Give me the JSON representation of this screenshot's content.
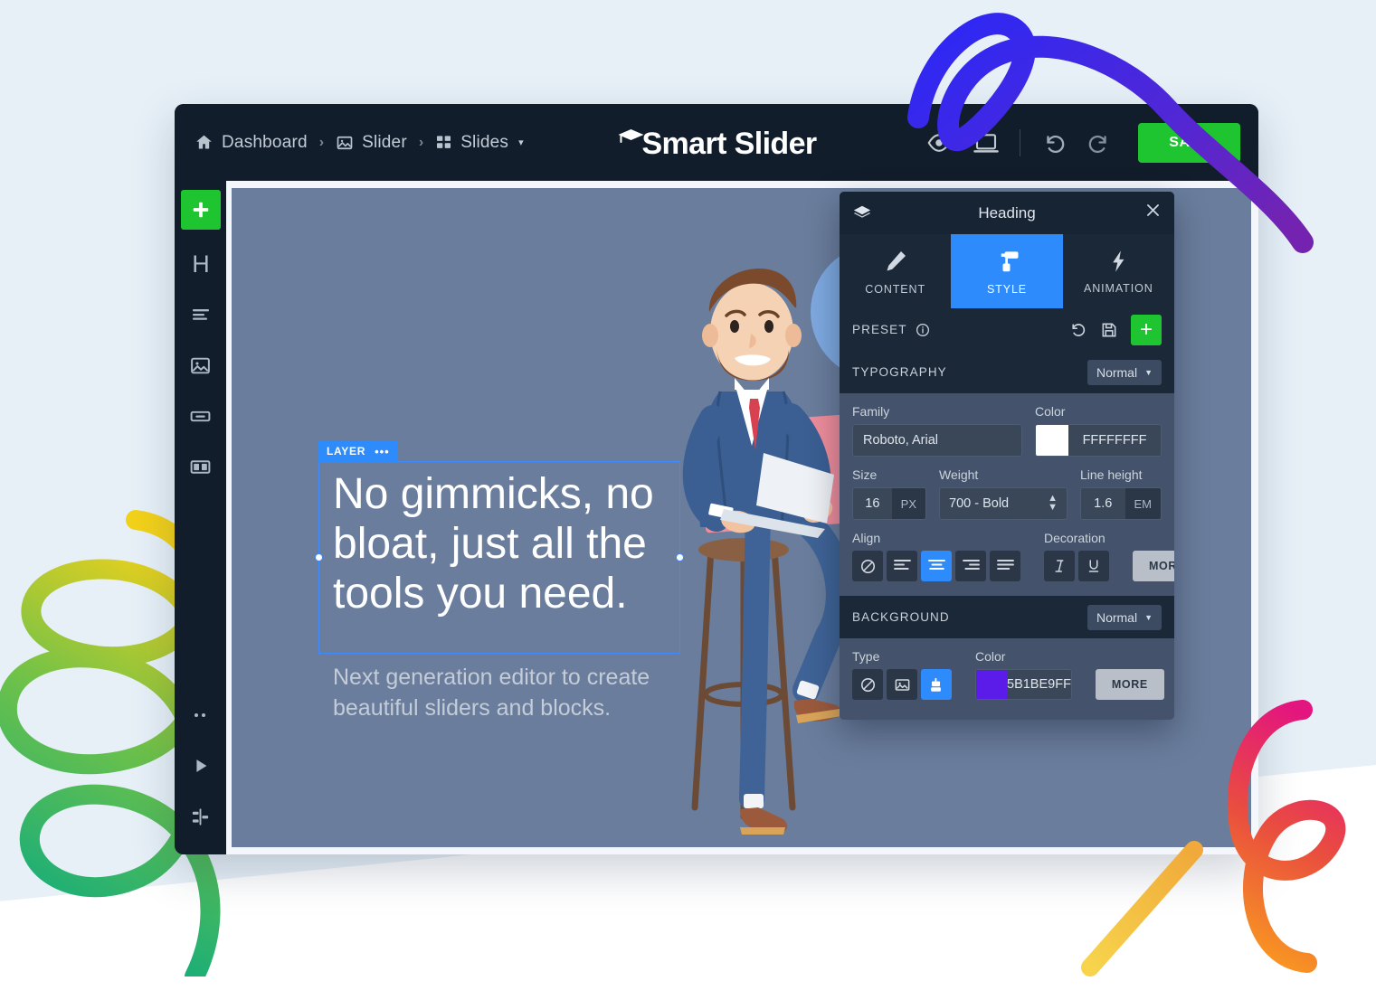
{
  "app": {
    "brand_name": "Smart Slider",
    "breadcrumb": [
      {
        "icon": "home-icon",
        "label": "Dashboard"
      },
      {
        "icon": "image-icon",
        "label": "Slider"
      },
      {
        "icon": "grid-icon",
        "label": "Slides",
        "caret": "▾"
      }
    ],
    "separator": "›",
    "toolbar": {
      "preview_icon": "eye-icon",
      "device_icon": "desktop-icon",
      "undo_icon": "undo-icon",
      "redo_icon": "redo-icon",
      "save_label": "SAVE",
      "save_color": "#1FC431"
    }
  },
  "sidebar": {
    "items": [
      {
        "name": "add-layer",
        "icon": "plus-icon",
        "label": "+"
      },
      {
        "name": "heading-layer",
        "icon": "heading-icon",
        "label": "H"
      },
      {
        "name": "text-layer",
        "icon": "text-icon"
      },
      {
        "name": "image-layer",
        "icon": "image-icon"
      },
      {
        "name": "button-layer",
        "icon": "button-icon"
      },
      {
        "name": "row-layer",
        "icon": "columns-icon"
      }
    ],
    "bottom_items": [
      {
        "name": "more-options",
        "icon": "dots-icon"
      },
      {
        "name": "play-preview",
        "icon": "play-icon"
      },
      {
        "name": "timeline",
        "icon": "timeline-icon"
      }
    ]
  },
  "canvas": {
    "layer_tag": "LAYER",
    "layer_menu": "•••",
    "headline": "No gimmicks, no bloat, just all the tools you need.",
    "subline": "Next generation editor to create beautiful sliders and blocks.",
    "background_color": "#6A7D9C"
  },
  "panel": {
    "title": "Heading",
    "layers_icon": "layers-icon",
    "close_icon": "close-icon",
    "tabs": [
      {
        "label": "CONTENT",
        "icon": "pencil-icon",
        "active": false
      },
      {
        "label": "STYLE",
        "icon": "paint-roller-icon",
        "active": true
      },
      {
        "label": "ANIMATION",
        "icon": "lightning-icon",
        "active": false
      }
    ],
    "preset": {
      "title": "PRESET",
      "info_icon": "info-icon",
      "reset_icon": "reset-icon",
      "save_icon": "floppy-disk-icon",
      "add_label": "+"
    },
    "typography": {
      "title": "TYPOGRAPHY",
      "state": "Normal",
      "family_label": "Family",
      "family_value": "Roboto, Arial",
      "color_label": "Color",
      "color_value": "FFFFFFFF",
      "color_hex": "#FFFFFF",
      "size_label": "Size",
      "size_value": "16",
      "size_unit": "PX",
      "weight_label": "Weight",
      "weight_value": "700 - Bold",
      "lineheight_label": "Line height",
      "lineheight_value": "1.6",
      "lineheight_unit": "EM",
      "align_label": "Align",
      "align_options": [
        "none",
        "left",
        "center",
        "right",
        "justify"
      ],
      "align_selected": "center",
      "decoration_label": "Decoration",
      "decoration_options": [
        "italic",
        "underline"
      ],
      "more_label": "MORE"
    },
    "background": {
      "title": "BACKGROUND",
      "state": "Normal",
      "type_label": "Type",
      "type_options": [
        "none",
        "image",
        "color"
      ],
      "type_selected": "color",
      "color_label": "Color",
      "color_value": "5B1BE9FF",
      "color_hex": "#5B1BE9",
      "more_label": "MORE"
    }
  },
  "decor": {
    "swirl_blue_purple": [
      "#3A2BF0",
      "#7423B0"
    ],
    "swirl_green": [
      "#F2D11A",
      "#00A886"
    ],
    "swirl_pink_orange": [
      "#E3157F",
      "#F89423"
    ],
    "swirl_yellow": [
      "#F7D44C",
      "#F0A93A"
    ]
  }
}
